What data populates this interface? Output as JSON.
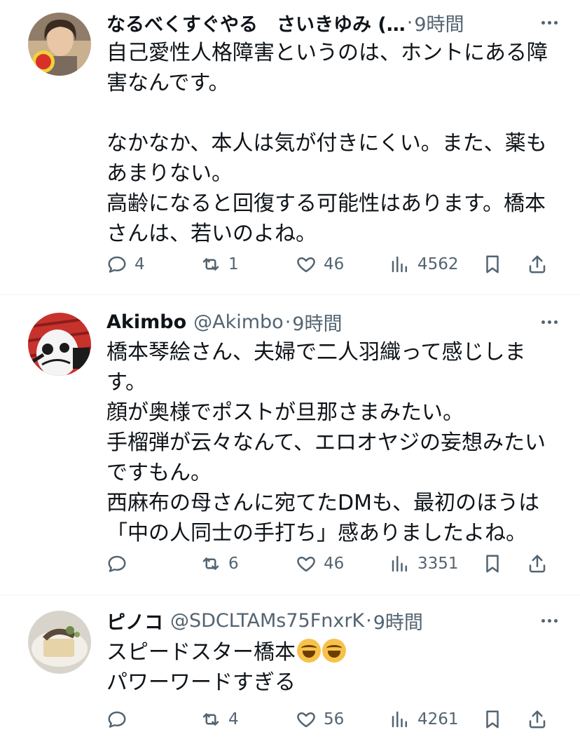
{
  "posts": [
    {
      "display_name": "なるべくすぐやる　さいきゆみ (…",
      "handle": "",
      "time": "9時間",
      "avatar": "woman-photo-avatar",
      "lines": [
        "自己愛性人格障害というのは、ホントにある障",
        "害なんです。",
        "",
        "なかなか、本人は気が付きにくい。また、薬も",
        "あまりない。",
        "高齢になると回復する可能性はあります。橋本",
        "さんは、若いのよね。"
      ],
      "replies": "4",
      "reposts": "1",
      "likes": "46",
      "views": "4562"
    },
    {
      "display_name": "Akimbo",
      "handle": "@Akimbo",
      "time": "9時間",
      "avatar": "bird-cartoon-avatar",
      "lines": [
        "橋本琴絵さん、夫婦で二人羽織って感じしま",
        "す。",
        "顔が奥様でポストが旦那さまみたい。",
        "手榴弾が云々なんて、エロオヤジの妄想みたい",
        "ですもん。",
        "西麻布の母さんに宛てたDMも、最初のほうは",
        "「中の人同士の手打ち」感ありましたよね。"
      ],
      "replies": "",
      "reposts": "6",
      "likes": "46",
      "views": "3351"
    },
    {
      "display_name": "ピノコ",
      "handle": "@SDCLTAMs75FnxrK",
      "time": "9時間",
      "avatar": "food-plate-avatar",
      "lines": [
        "スピードスター橋本",
        "パワーワードすぎる"
      ],
      "emoji": "rolling-on-floor-laughing-emoji",
      "replies": "",
      "reposts": "4",
      "likes": "56",
      "views": "4261"
    }
  ],
  "sep": "·"
}
